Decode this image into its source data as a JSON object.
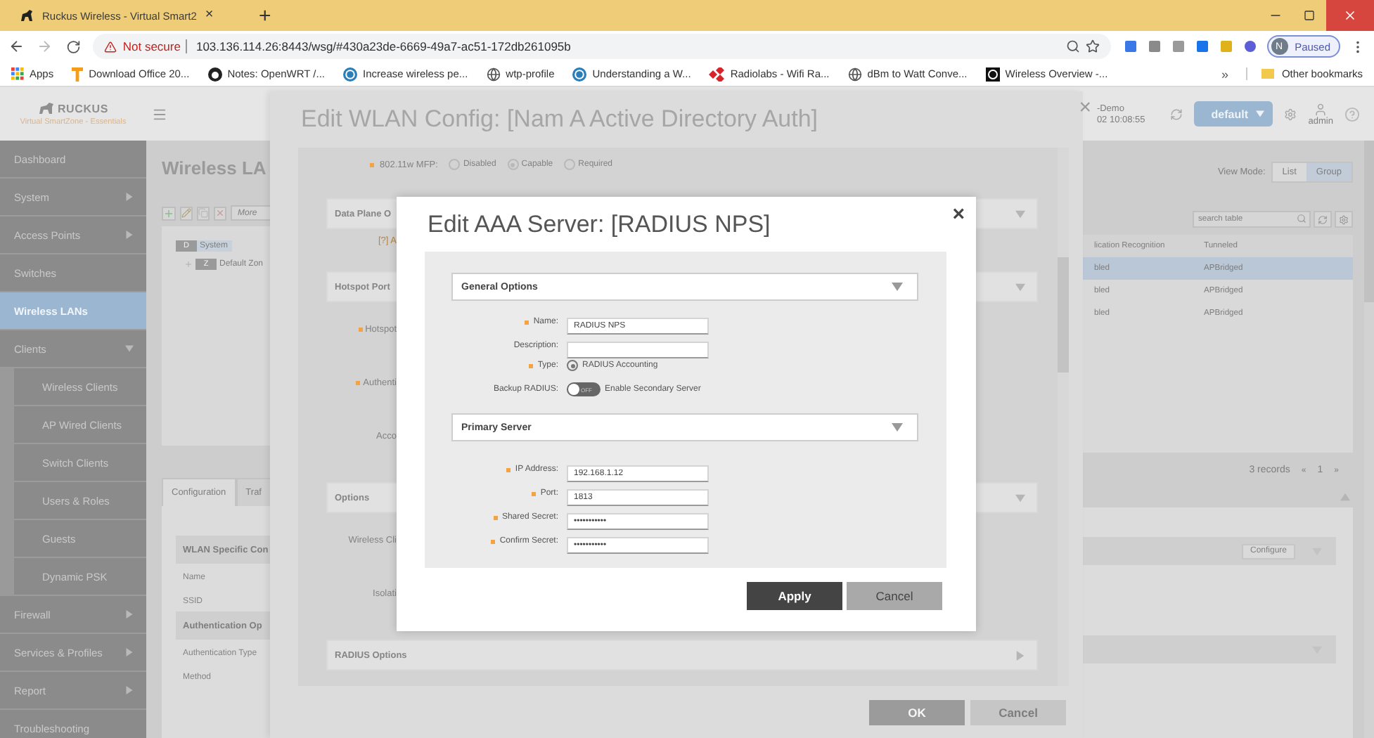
{
  "browser": {
    "tab_title": "Ruckus Wireless - Virtual Smart2",
    "tab_close": "×",
    "new_tab": "+",
    "security": "Not secure",
    "url": "103.136.114.26:8443/wsg/#430a23de-6669-49a7-ac51-172db261095b",
    "profile": {
      "initial": "N",
      "status": "Paused"
    },
    "bookmarks": [
      {
        "kind": "apps",
        "label": "Apps"
      },
      {
        "kind": "office",
        "label": "Download Office 20..."
      },
      {
        "kind": "github",
        "label": "Notes: OpenWRT /..."
      },
      {
        "kind": "wordpress",
        "label": "Increase wireless pe..."
      },
      {
        "kind": "globe",
        "label": "wtp-profile"
      },
      {
        "kind": "wordpress",
        "label": "Understanding a W..."
      },
      {
        "kind": "radiolabs",
        "label": "Radiolabs - Wifi Ra..."
      },
      {
        "kind": "globe",
        "label": "dBm to Watt Conve..."
      },
      {
        "kind": "hp",
        "label": "Wireless Overview -..."
      }
    ],
    "more_bookmarks": "»",
    "other_bookmarks": "Other bookmarks"
  },
  "app": {
    "logo": "RUCKUS",
    "product": "Virtual SmartZone - Essentials",
    "header": {
      "system_name": "-Demo",
      "time": "02 10:08:55",
      "domain": "default",
      "user": "admin"
    },
    "sidebar": [
      {
        "label": "Dashboard",
        "selected": false
      },
      {
        "label": "System",
        "selected": false,
        "expanded": false
      },
      {
        "label": "Access Points",
        "selected": false,
        "expanded": false
      },
      {
        "label": "Switches",
        "selected": false
      },
      {
        "label": "Wireless LANs",
        "selected": true
      },
      {
        "label": "Clients",
        "selected": false,
        "expanded": true,
        "children": [
          {
            "label": "Wireless Clients",
            "selected": false
          },
          {
            "label": "AP Wired Clients",
            "selected": false
          },
          {
            "label": "Switch Clients",
            "selected": false
          },
          {
            "label": "Users & Roles",
            "selected": false
          },
          {
            "label": "Guests",
            "selected": false
          },
          {
            "label": "Dynamic PSK",
            "selected": false
          }
        ]
      },
      {
        "label": "Firewall",
        "selected": false,
        "expanded": false
      },
      {
        "label": "Services & Profiles",
        "selected": false,
        "expanded": false
      },
      {
        "label": "Report",
        "selected": false,
        "expanded": false
      },
      {
        "label": "Troubleshooting",
        "selected": false
      }
    ],
    "page_title": "Wireless LA",
    "toolbar": {
      "more": "More"
    },
    "tree": [
      {
        "badge": "D",
        "label": "System",
        "selected": true,
        "children": [
          {
            "badge": "Z",
            "label": "Default Zon",
            "selected": false
          }
        ]
      }
    ],
    "view_mode": {
      "label": "View Mode:",
      "options": [
        {
          "label": "List",
          "selected": false
        },
        {
          "label": "Group",
          "selected": true
        }
      ]
    },
    "search": {
      "placeholder": "search table"
    },
    "table": {
      "columns": [
        "lication Recognition",
        "Tunneled"
      ],
      "rows": [
        {
          "cells": [
            "bled",
            "APBridged"
          ],
          "selected": true
        },
        {
          "cells": [
            "bled",
            "APBridged"
          ],
          "selected": false
        },
        {
          "cells": [
            "bled",
            "APBridged"
          ],
          "selected": false
        }
      ]
    },
    "pagination": {
      "records": "3 records",
      "prev": "«",
      "page": "1",
      "next": "»"
    },
    "detail": {
      "tabs": [
        {
          "label": "Configuration",
          "selected": true
        },
        {
          "label": "Traf",
          "selected": false
        }
      ],
      "sections": [
        {
          "title": "WLAN Specific Con",
          "fields": [
            "Name",
            "SSID"
          ]
        },
        {
          "title": "Authentication Op",
          "fields": [
            "Authentication Type",
            "Method"
          ]
        }
      ],
      "configure": "Configure"
    }
  },
  "wlan_panel": {
    "title": "Edit WLAN Config: [Nam A Active Directory Auth]",
    "close": "×",
    "mfp": {
      "label": "802.11w MFP:",
      "required": true,
      "options": [
        {
          "label": "Disabled",
          "selected": false
        },
        {
          "label": "Capable",
          "selected": true
        },
        {
          "label": "Required",
          "selected": false
        }
      ]
    },
    "items": [
      {
        "kind": "section",
        "label": "Data Plane O",
        "collapsed": false
      },
      {
        "kind": "note",
        "label": "[?] A"
      },
      {
        "kind": "section",
        "label": "Hotspot Port",
        "collapsed": false
      },
      {
        "kind": "field",
        "label": "Hotspot",
        "required": true
      },
      {
        "kind": "field",
        "label": "Authenti",
        "required": true
      },
      {
        "kind": "field",
        "label": "Acco",
        "required": false
      },
      {
        "kind": "section",
        "label": "Options",
        "collapsed": false
      },
      {
        "kind": "field",
        "label": "Wireless Cli",
        "required": false
      },
      {
        "kind": "field",
        "label": "Isolati",
        "required": false
      },
      {
        "kind": "section",
        "label": "RADIUS Options",
        "collapsed": true
      }
    ],
    "buttons": [
      {
        "label": "OK",
        "kind": "primary"
      },
      {
        "label": "Cancel",
        "kind": "secondary"
      }
    ]
  },
  "dialog": {
    "title": "Edit AAA Server: [RADIUS NPS]",
    "close": "×",
    "sections": [
      {
        "title": "General Options",
        "fields": [
          {
            "kind": "text",
            "label": "Name:",
            "required": true,
            "value": "RADIUS NPS"
          },
          {
            "kind": "text",
            "label": "Description:",
            "required": false
          },
          {
            "kind": "radio",
            "label": "Type:",
            "required": true,
            "option": "RADIUS Accounting",
            "selected": true
          },
          {
            "kind": "toggle",
            "label": "Backup RADIUS:",
            "required": false,
            "on": false,
            "state_text": "OFF",
            "caption": "Enable Secondary Server"
          }
        ]
      },
      {
        "title": "Primary Server",
        "fields": [
          {
            "kind": "text",
            "label": "IP Address:",
            "required": true,
            "value": "192.168.1.12"
          },
          {
            "kind": "text",
            "label": "Port:",
            "required": true,
            "value": "1813"
          },
          {
            "kind": "text",
            "label": "Shared Secret:",
            "required": true,
            "value": "•••••••••••"
          },
          {
            "kind": "text",
            "label": "Confirm Secret:",
            "required": true,
            "value": "•••••••••••"
          }
        ]
      }
    ],
    "buttons": [
      {
        "label": "Apply",
        "kind": "primary"
      },
      {
        "label": "Cancel",
        "kind": "secondary"
      }
    ]
  }
}
